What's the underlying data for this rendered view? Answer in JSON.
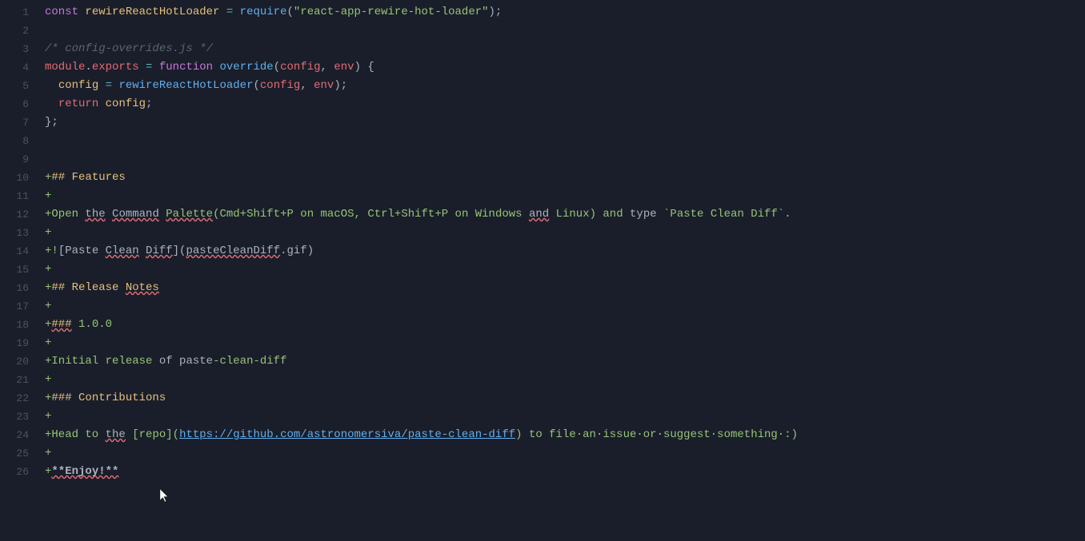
{
  "editor": {
    "background": "#1a1e2a",
    "lines": [
      {
        "number": 1,
        "type": "code",
        "content": "code_line_1"
      },
      {
        "number": 2,
        "type": "empty"
      },
      {
        "number": 3,
        "type": "code",
        "content": "code_line_3"
      },
      {
        "number": 4,
        "type": "code",
        "content": "code_line_4"
      },
      {
        "number": 5,
        "type": "code",
        "content": "code_line_5"
      },
      {
        "number": 6,
        "type": "code",
        "content": "code_line_6"
      },
      {
        "number": 7,
        "type": "code",
        "content": "code_line_7"
      },
      {
        "number": 8,
        "type": "empty"
      },
      {
        "number": 9,
        "type": "empty"
      },
      {
        "number": 10,
        "type": "diff"
      },
      {
        "number": 11,
        "type": "diff"
      },
      {
        "number": 12,
        "type": "diff"
      },
      {
        "number": 13,
        "type": "diff"
      },
      {
        "number": 14,
        "type": "diff"
      },
      {
        "number": 15,
        "type": "diff"
      },
      {
        "number": 16,
        "type": "diff"
      },
      {
        "number": 17,
        "type": "diff"
      },
      {
        "number": 18,
        "type": "diff"
      },
      {
        "number": 19,
        "type": "diff"
      },
      {
        "number": 20,
        "type": "diff"
      },
      {
        "number": 21,
        "type": "diff"
      },
      {
        "number": 22,
        "type": "diff"
      },
      {
        "number": 23,
        "type": "diff"
      },
      {
        "number": 24,
        "type": "diff"
      },
      {
        "number": 25,
        "type": "diff"
      },
      {
        "number": 26,
        "type": "diff"
      }
    ]
  }
}
